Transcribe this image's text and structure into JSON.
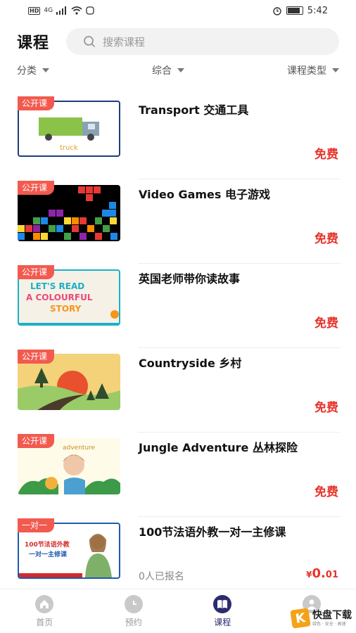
{
  "status_bar": {
    "signal": "4G",
    "time": "5:42"
  },
  "header": {
    "title": "课程",
    "search_placeholder": "搜索课程"
  },
  "filters": [
    {
      "label": "分类"
    },
    {
      "label": "综合"
    },
    {
      "label": "课程类型"
    }
  ],
  "courses": [
    {
      "badge": "公开课",
      "title": "Transport 交通工具",
      "price": "免费",
      "thumb_text": "truck"
    },
    {
      "badge": "公开课",
      "title": "Video Games 电子游戏",
      "price": "免费"
    },
    {
      "badge": "公开课",
      "title": "英国老师带你读故事",
      "price": "免费",
      "thumb_text_1": "LET'S READ",
      "thumb_text_2": "A COLOURFUL",
      "thumb_text_3": "STORY"
    },
    {
      "badge": "公开课",
      "title": "Countryside 乡村",
      "price": "免费"
    },
    {
      "badge": "公开课",
      "title": "Jungle Adventure 丛林探险",
      "price": "免费",
      "thumb_text": "adventure"
    },
    {
      "badge": "一对一",
      "title": "100节法语外教一对一主修课",
      "enrolled": "0人已报名",
      "price_symbol": "¥",
      "price_main": "0.",
      "price_cents": "01",
      "thumb_text_1": "100节法语外教",
      "thumb_text_2": "一对一主修课"
    }
  ],
  "tabbar": [
    {
      "label": "首页",
      "icon": "home-icon"
    },
    {
      "label": "预约",
      "icon": "clock-icon"
    },
    {
      "label": "课程",
      "icon": "book-icon",
      "active": true
    },
    {
      "label": "我的",
      "icon": "user-icon"
    }
  ],
  "watermark": {
    "letter": "K",
    "text": "快盘下载",
    "sub": "绿色 · 安全 · 高速"
  },
  "colors": {
    "accent": "#2b2d6e",
    "price": "#e6332a",
    "badge": "#f25a4f"
  }
}
